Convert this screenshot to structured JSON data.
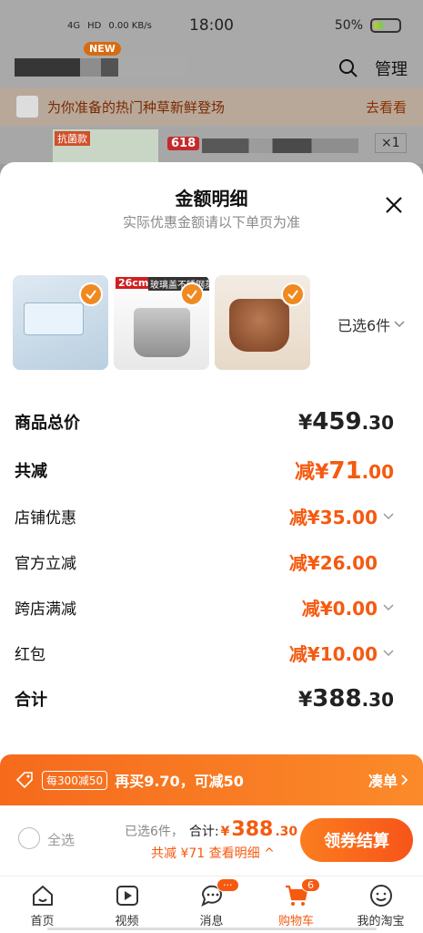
{
  "status_bar": {
    "time": "18:00",
    "signal": "4G",
    "hd": "HD",
    "speed": "0.00 KB/s",
    "battery": "50%"
  },
  "background": {
    "new_badge": "NEW",
    "manage": "管理",
    "promo_text": "为你准备的热门种草新鲜登场",
    "promo_link": "去看看",
    "antibac_tag": "抗菌款",
    "tag_618": "618",
    "quantity": "×1"
  },
  "sheet": {
    "title": "金额明细",
    "subtitle": "实际优惠金额请以下单页为准",
    "product_tags": {
      "size": "26cm",
      "lid": "玻璃盖不锈钢蒸锅"
    },
    "selected": "已选6件"
  },
  "breakdown": {
    "total_label": "商品总价",
    "total": {
      "cur": "¥",
      "int": "459",
      "dec": ".30"
    },
    "reduce_label": "共减",
    "reduce": {
      "pre": "减",
      "cur": "¥",
      "int": "71",
      "dec": ".00"
    },
    "items": [
      {
        "label": "店铺优惠",
        "value": "减¥35.00"
      },
      {
        "label": "官方立减",
        "value": "减¥26.00"
      },
      {
        "label": "跨店满减",
        "value": "减¥0.00"
      },
      {
        "label": "红包",
        "value": "减¥10.00"
      }
    ],
    "sum_label": "合计",
    "sum": {
      "cur": "¥",
      "int": "388",
      "dec": ".30"
    }
  },
  "discount_bar": {
    "pill": "每300减50",
    "message": "再买9.70，可减50",
    "action": "凑单"
  },
  "checkout": {
    "select_all": "全选",
    "selected_count": "已选6件，",
    "total_label": "合计:",
    "cur": "¥",
    "int": "388",
    "dec": ".30",
    "saved": "共减 ¥71  查看明细 ^",
    "pay_button": "领券结算"
  },
  "tabbar": [
    {
      "label": "首页",
      "icon": "home-icon"
    },
    {
      "label": "视频",
      "icon": "video-icon"
    },
    {
      "label": "消息",
      "icon": "message-icon",
      "badge": "···"
    },
    {
      "label": "购物车",
      "icon": "cart-icon",
      "badge": "6"
    },
    {
      "label": "我的淘宝",
      "icon": "profile-icon"
    }
  ],
  "colors": {
    "accent": "#f55a10",
    "orange_gradient_start": "#f66a1c",
    "text": "#222222"
  }
}
